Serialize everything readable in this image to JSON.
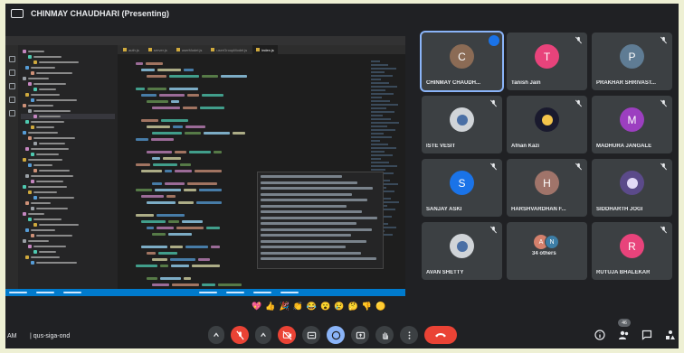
{
  "presenter": {
    "name": "CHINMAY CHAUDHARI (Presenting)"
  },
  "screen_share": {
    "editor_tabs": [
      "auth.js",
      "server.js",
      "userModel.js",
      "userGroupModel.js",
      "index.js"
    ],
    "active_tab_index": 4
  },
  "participants": [
    {
      "name": "CHINMAY CHAUDH...",
      "initial": "C",
      "color": "#8b6b55",
      "speaking": true
    },
    {
      "name": "Tanish Jain",
      "initial": "T",
      "color": "#e8437b",
      "speaking": false
    },
    {
      "name": "PRAKHAR SHRIVAST...",
      "initial": "P",
      "color": "#5f7c94",
      "speaking": false
    },
    {
      "name": "ISTE VESIT",
      "initial": "",
      "color": "img",
      "speaking": false
    },
    {
      "name": "Afnan Kazi",
      "initial": "",
      "color": "img-dark",
      "speaking": false
    },
    {
      "name": "MADHURA JANGALE",
      "initial": "M",
      "color": "#9c3fc0",
      "speaking": false
    },
    {
      "name": "SANJAY ASKI",
      "initial": "S",
      "color": "#1a73e8",
      "speaking": false
    },
    {
      "name": "HARSHVARDHAN F...",
      "initial": "H",
      "color": "#a0746a",
      "speaking": false
    },
    {
      "name": "SIDDHARTH JOGI",
      "initial": "",
      "color": "img-purple",
      "speaking": false
    },
    {
      "name": "AVAN SHETTY",
      "initial": "",
      "color": "img",
      "speaking": false
    },
    {
      "name": "34 others",
      "initial": "",
      "color": "others",
      "speaking": false
    },
    {
      "name": "RUTUJA BHALEKAR",
      "initial": "R",
      "color": "#e8437b",
      "speaking": false
    }
  ],
  "others_initials": [
    "A",
    "N"
  ],
  "reactions": [
    "💖",
    "👍",
    "🎉",
    "👏",
    "😂",
    "😮",
    "😢",
    "🤔",
    "👎",
    "🟡"
  ],
  "meeting": {
    "time": "AM",
    "separator": "|",
    "code": "qus-siga-ond",
    "participant_count": "46"
  }
}
